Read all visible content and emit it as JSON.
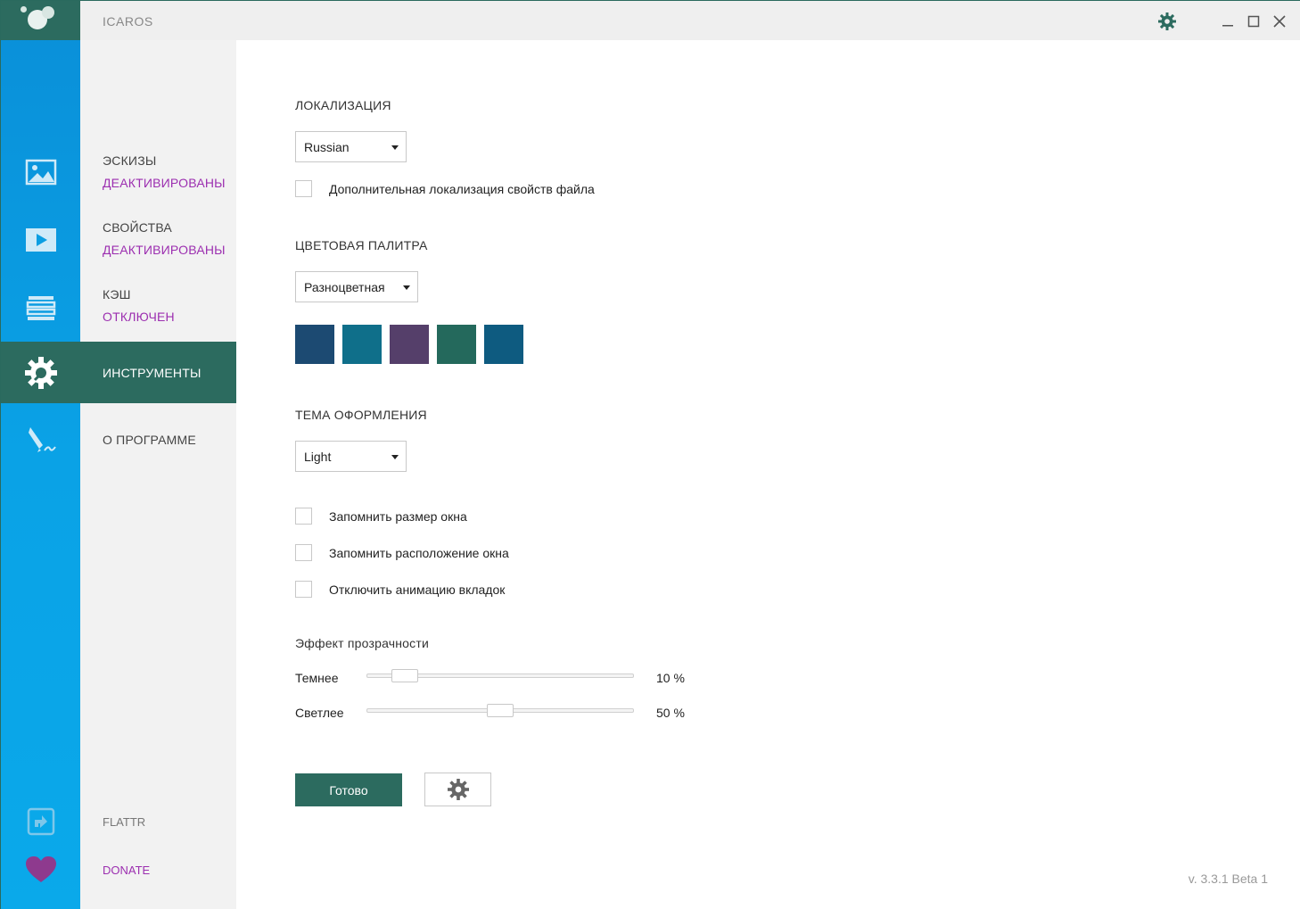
{
  "app": {
    "title": "ICAROS",
    "version": "v. 3.3.1 Beta 1"
  },
  "titlebar": {
    "icons": [
      "gear-icon",
      "minimize-icon",
      "maximize-icon",
      "close-icon"
    ]
  },
  "rail": {
    "icons": [
      "image-icon",
      "video-play-icon",
      "cache-stack-icon",
      "tools-gear-icon",
      "pen-icon",
      "flattr-icon",
      "heart-icon"
    ]
  },
  "nav": {
    "items": [
      {
        "title": "ЭСКИЗЫ",
        "status": "ДЕАКТИВИРОВАНЫ"
      },
      {
        "title": "СВОЙСТВА",
        "status": "ДЕАКТИВИРОВАНЫ"
      },
      {
        "title": "КЭШ",
        "status": "ОТКЛЮЧЕН"
      },
      {
        "title": "ИНСТРУМЕНТЫ"
      },
      {
        "title": "О ПРОГРАММЕ"
      }
    ],
    "flattr": "FLATTR",
    "donate": "DONATE"
  },
  "localization": {
    "title": "ЛОКАЛИЗАЦИЯ",
    "selected": "Russian",
    "extra_checkbox": "Дополнительная локализация свойств файла"
  },
  "palette": {
    "title": "ЦВЕТОВАЯ ПАЛИТРА",
    "selected": "Разноцветная",
    "swatches": [
      "#1c4a72",
      "#0f6f8a",
      "#553f6a",
      "#24695c",
      "#0e5b80"
    ]
  },
  "theme": {
    "title": "ТЕМА ОФОРМЛЕНИЯ",
    "selected": "Light"
  },
  "options": {
    "remember_size": "Запомнить размер окна",
    "remember_position": "Запомнить расположение окна",
    "disable_animation": "Отключить анимацию вкладок"
  },
  "transparency": {
    "title": "Эффект прозрачности",
    "darker": {
      "label": "Темнее",
      "value": "10 %",
      "level": 0.1
    },
    "lighter": {
      "label": "Светлее",
      "value": "50 %",
      "level": 0.5
    }
  },
  "buttons": {
    "done": "Готово"
  },
  "colors": {
    "accent": "#2c6b5f",
    "status": "#9c2fb0",
    "rail": "#0aa2e6"
  }
}
